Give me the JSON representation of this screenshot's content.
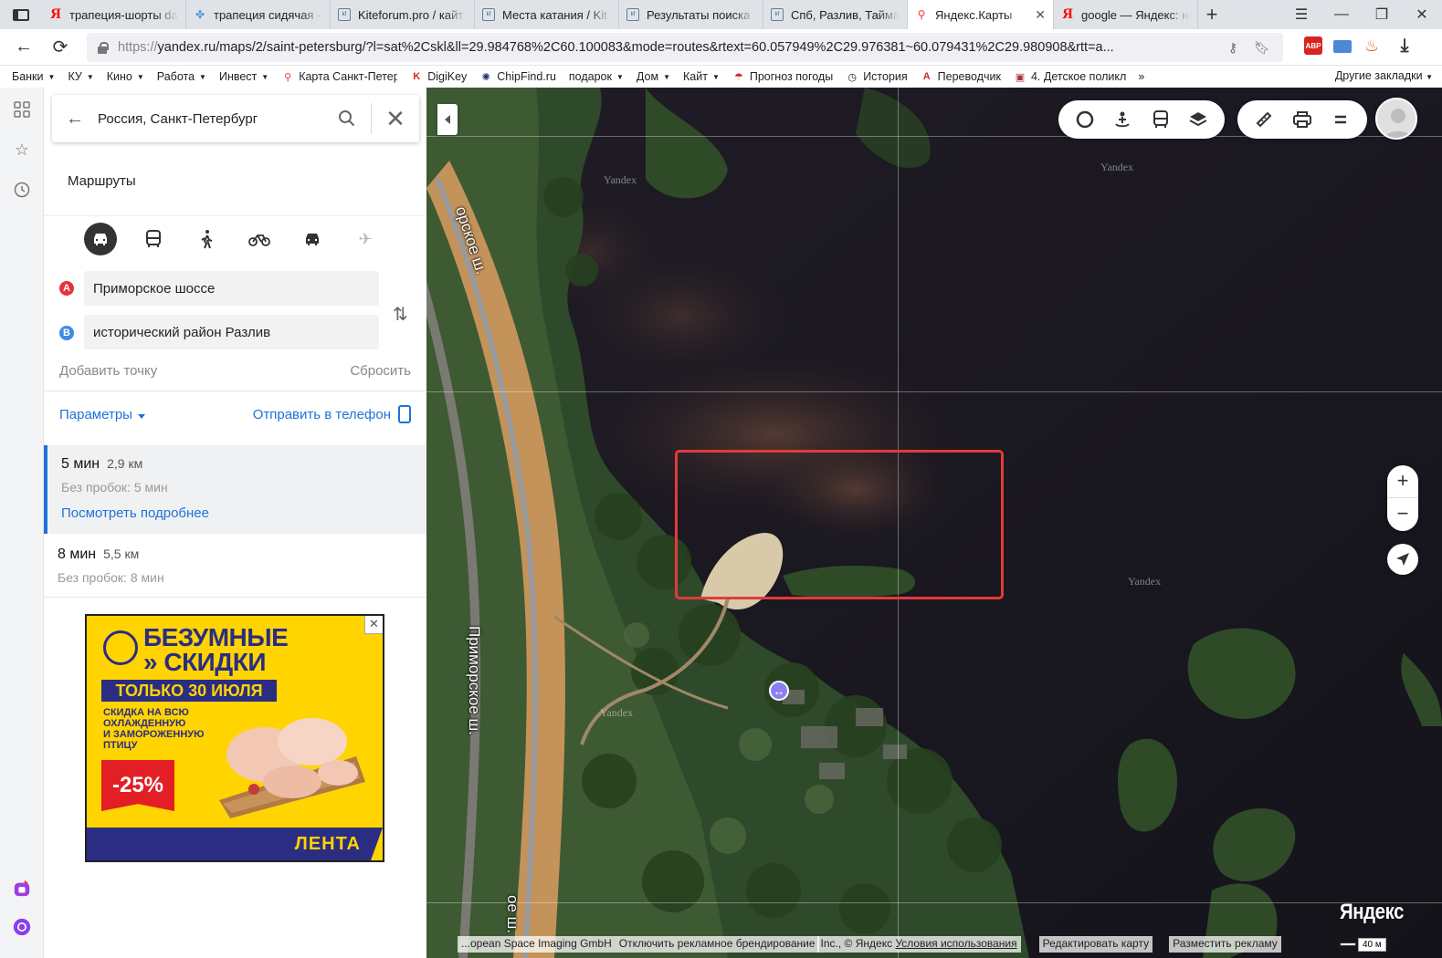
{
  "tabs": [
    {
      "title": "трапеция-шорты da",
      "favicon": "Я",
      "active": false
    },
    {
      "title": "трапеция сидячая -",
      "favicon": "✤",
      "active": false
    },
    {
      "title": "Kiteforum.pro / кайт",
      "favicon": "kf",
      "active": false
    },
    {
      "title": "Места катания / Kit",
      "favicon": "kf",
      "active": false
    },
    {
      "title": "Результаты поиска",
      "favicon": "kf",
      "active": false
    },
    {
      "title": "Спб, Разлив, Таймау",
      "favicon": "kf",
      "active": false
    },
    {
      "title": "Яндекс.Карты",
      "favicon": "pin",
      "active": true
    },
    {
      "title": "google — Яндекс: н",
      "favicon": "Я",
      "active": false
    }
  ],
  "address": {
    "scheme": "https://",
    "rest": "yandex.ru/maps/2/saint-petersburg/?l=sat%2Cskl&ll=29.984768%2C60.100083&mode=routes&rtext=60.057949%2C29.976381~60.079431%2C29.980908&rtt=a..."
  },
  "extensions": [
    "ABP",
    "mail",
    "fire",
    "download"
  ],
  "bookmarks": [
    {
      "label": "Банки",
      "dd": true,
      "icon": ""
    },
    {
      "label": "КУ",
      "dd": true,
      "icon": ""
    },
    {
      "label": "Кино",
      "dd": true,
      "icon": ""
    },
    {
      "label": "Работа",
      "dd": true,
      "icon": ""
    },
    {
      "label": "Инвест",
      "dd": true,
      "icon": ""
    },
    {
      "label": "Карта Санкт-Петер",
      "dd": false,
      "icon": "pin"
    },
    {
      "label": "DigiKey",
      "dd": false,
      "icon": "dk"
    },
    {
      "label": "ChipFind.ru",
      "dd": false,
      "icon": "cf"
    },
    {
      "label": "подарок",
      "dd": true,
      "icon": ""
    },
    {
      "label": "Дом",
      "dd": true,
      "icon": ""
    },
    {
      "label": "Кайт",
      "dd": true,
      "icon": ""
    },
    {
      "label": "Прогноз погоды",
      "dd": false,
      "icon": "umb"
    },
    {
      "label": "История",
      "dd": false,
      "icon": "clock"
    },
    {
      "label": "Переводчик",
      "dd": false,
      "icon": "tr"
    },
    {
      "label": "4. Детское поликл",
      "dd": false,
      "icon": "dp"
    }
  ],
  "bookmarks_more": "»",
  "bookmarks_other": "Другие закладки",
  "search": {
    "query": "Россия, Санкт-Петербург"
  },
  "panel": {
    "title": "Маршруты",
    "point_a_label": "A",
    "point_b_label": "B",
    "point_a": "Приморское шоссе",
    "point_b": "исторический район Разлив",
    "add_point": "Добавить точку",
    "reset": "Сбросить",
    "params": "Параметры",
    "send": "Отправить в телефон"
  },
  "routes": [
    {
      "time": "5 мин",
      "dist": "2,9 км",
      "no_traffic": "Без пробок: 5 мин",
      "details": "Посмотреть подробнее"
    },
    {
      "time": "8 мин",
      "dist": "5,5 км",
      "no_traffic": "Без пробок: 8 мин"
    }
  ],
  "ad": {
    "line1": "БЕЗУМНЫЕ",
    "line2": "» СКИДКИ",
    "band": "ТОЛЬКО 30 ИЮЛЯ",
    "text1": "СКИДКА НА ВСЮ",
    "text2": "ОХЛАЖДЕННУЮ",
    "text3": "И ЗАМОРОЖЕННУЮ",
    "text4": "ПТИЦУ",
    "pct": "-25%",
    "logo": "ЛЕНТА",
    "close": "✕"
  },
  "map": {
    "road_label_1": "Приморское ш.",
    "road_label_2": "орское ш.",
    "road_label_3": "ое ш.",
    "watermark": "Yandex",
    "logo": "Яндекс",
    "copyright_1": "...opean Space Imaging GmbH",
    "copyright_2": "Отключить рекламное брендирование",
    "copyright_3": "Inc., © Яндекс",
    "terms": "Условия использования",
    "edit": "Редактировать карту",
    "place_ad": "Разместить рекламу",
    "scale": "40 м",
    "zoom_in": "+",
    "zoom_out": "−"
  },
  "colors": {
    "accent": "#1e73d8",
    "route_a": "#e8333a",
    "route_b": "#3d8ae8",
    "highlight": "#e33a3a",
    "ad_yellow": "#ffd400",
    "ad_blue": "#2b2d82"
  }
}
